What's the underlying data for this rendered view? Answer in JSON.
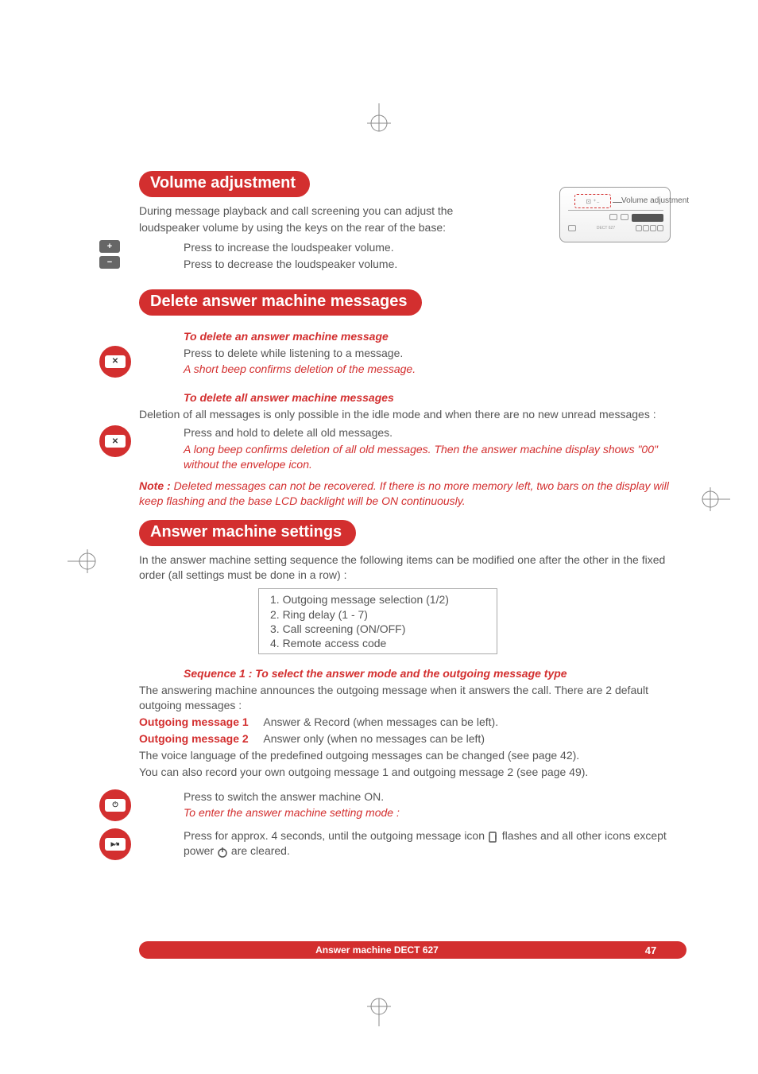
{
  "sections": {
    "volume": {
      "title": "Volume adjustment",
      "intro1": "During message playback and call screening you can adjust the",
      "intro2": "loudspeaker volume by using the keys on the rear of the base:",
      "increase": "Press to increase the loudspeaker volume.",
      "decrease": "Press to decrease the loudspeaker volume.",
      "device_label": "Volume adjustment"
    },
    "delete": {
      "title": "Delete answer machine messages",
      "sub1": "To delete an answer machine message",
      "line1": "Press to delete while listening to a message.",
      "line1b": "A short beep confirms deletion of the message.",
      "sub2": "To delete all answer machine messages",
      "line2": "Deletion of all messages is only possible in the idle mode and when there are no new unread messages :",
      "line3": "Press and hold to delete all old messages.",
      "line3b": "A long beep confirms deletion of all old messages. Then the answer machine display shows \"00\" without the envelope icon.",
      "note_label": "Note :",
      "note": "Deleted messages can not be recovered. If there is no more memory left, two bars on the display will keep flashing and the base LCD backlight will be ON continuously."
    },
    "settings": {
      "title": "Answer machine settings",
      "intro": "In the answer machine setting sequence the following items can be modified one after the other in the fixed order (all settings must be done in a row) :",
      "items": {
        "i1": "1. Outgoing message selection (1/2)",
        "i2": "2. Ring delay (1 - 7)",
        "i3": "3. Call screening (ON/OFF)",
        "i4": "4. Remote access code"
      },
      "seq1_title": "Sequence 1 : To select the answer mode and the outgoing message type",
      "seq1_intro": "The answering machine announces the outgoing message when it answers the call. There are 2 default outgoing messages :",
      "om1_label": "Outgoing message 1",
      "om1_desc": "Answer & Record (when messages can be left).",
      "om2_label": "Outgoing message 2",
      "om2_desc": "Answer only (when no messages can be left)",
      "voice_lang": "The voice language of the predefined outgoing messages can be changed (see page 42).",
      "record_own": "You can also record your own outgoing message 1 and outgoing message 2 (see page 49).",
      "press_on": "Press to switch the answer machine ON.",
      "enter_mode": "To enter the answer machine setting mode :",
      "press_4s_a": "Press for approx. 4 seconds, until the outgoing message icon ",
      "press_4s_b": " flashes and all other icons except power ",
      "press_4s_c": " are cleared."
    }
  },
  "footer": {
    "title": "Answer machine DECT 627",
    "page": "47"
  },
  "icons": {
    "plus": "+",
    "minus": "−",
    "x": "✕",
    "power": "⏻",
    "play": "▶∕■"
  }
}
